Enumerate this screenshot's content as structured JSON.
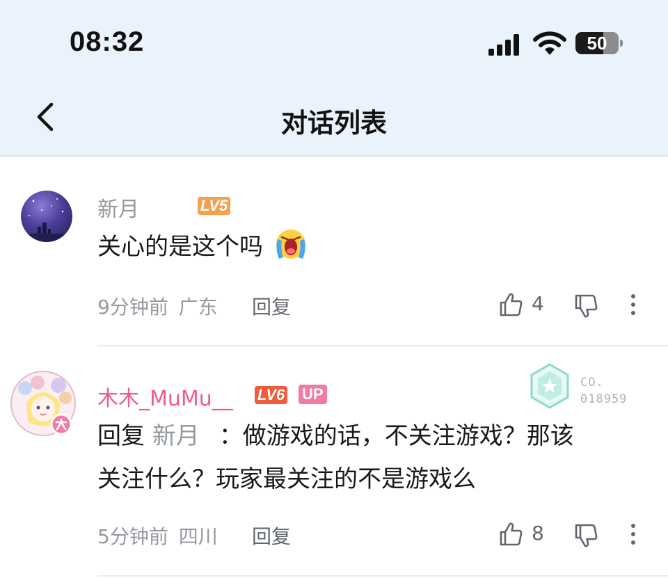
{
  "status_bar": {
    "time": "08:32",
    "battery": "50"
  },
  "header": {
    "title": "对话列表"
  },
  "comments": [
    {
      "username": "新月",
      "level": "LV5",
      "content": "关心的是这个吗",
      "emoji": "crying-face-emoji",
      "time": "9分钟前",
      "location": "广东",
      "reply_label": "回复",
      "likes": "4"
    },
    {
      "username": "木木_MuMu__",
      "level": "LV6",
      "up_badge": "UP",
      "medal": {
        "line1": "CO.",
        "line2": "018959"
      },
      "reply_prefix": "回复",
      "reply_to": "新月",
      "content_line1": "：做游戏的话，不关注游戏？那该",
      "content_line2": "关注什么？玩家最关注的不是游戏么",
      "time": "5分钟前",
      "location": "四川",
      "reply_label": "回复",
      "likes": "8"
    }
  ],
  "colors": {
    "level5": "#f6a04d",
    "level6": "#ef5b3b",
    "up": "#f27aa6",
    "vip_name": "#f05c8a",
    "header_bg": "#eaf3fb"
  }
}
